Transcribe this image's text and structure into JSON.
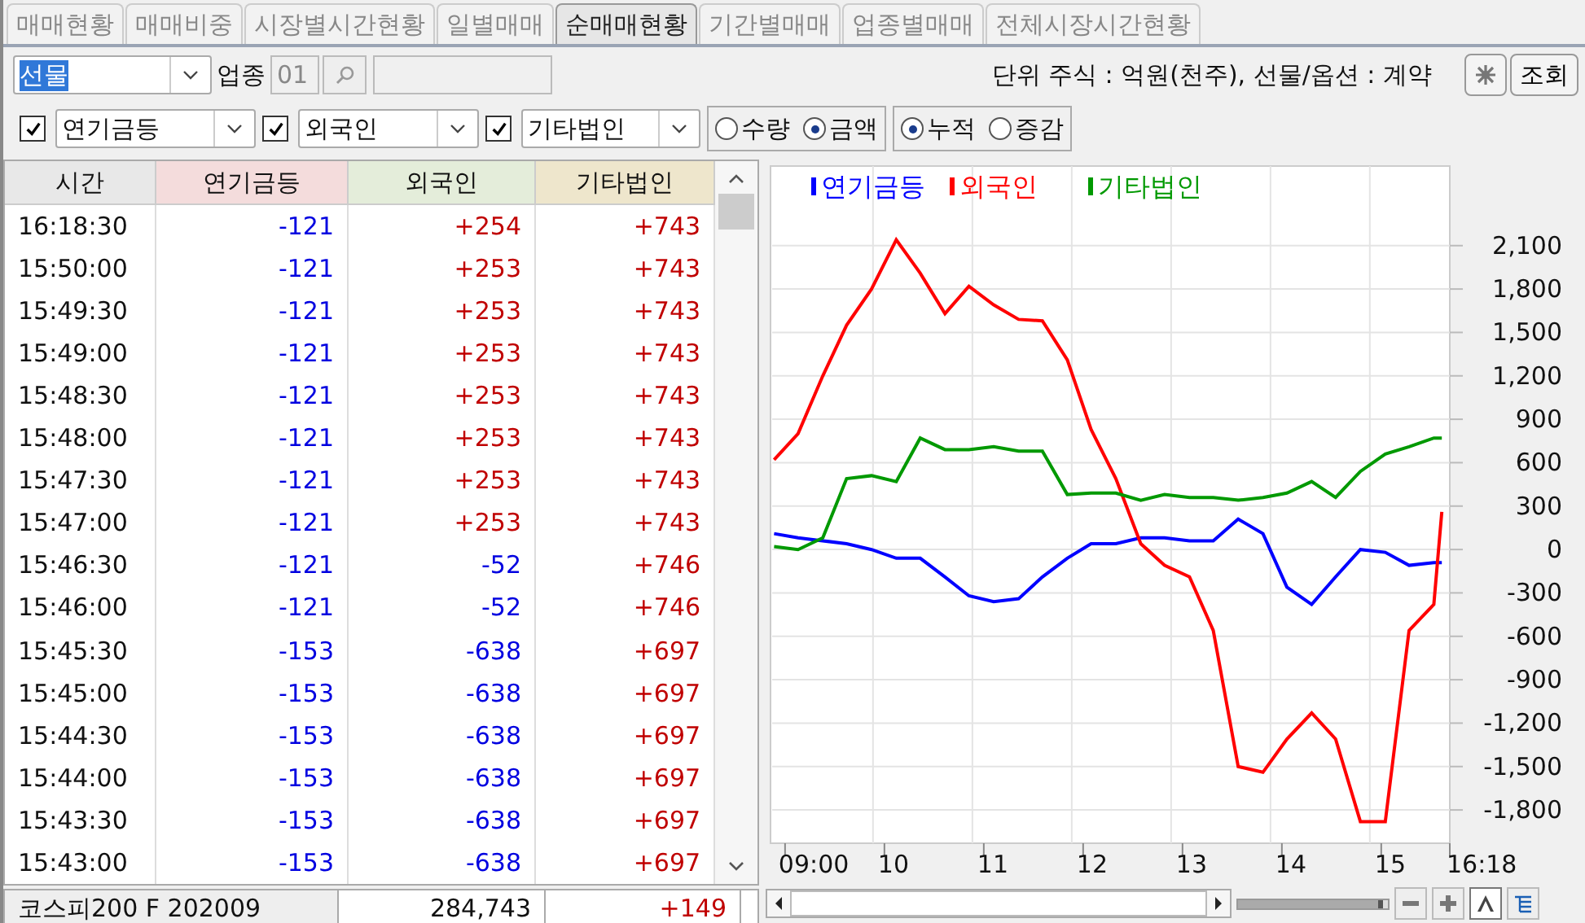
{
  "tabs": [
    {
      "label": "매매현황",
      "selected": false
    },
    {
      "label": "매매비중",
      "selected": false
    },
    {
      "label": "시장별시간현황",
      "selected": false
    },
    {
      "label": "일별매매",
      "selected": false
    },
    {
      "label": "순매매현황",
      "selected": true
    },
    {
      "label": "기간별매매",
      "selected": false
    },
    {
      "label": "업종별매매",
      "selected": false
    },
    {
      "label": "전체시장시간현황",
      "selected": false
    }
  ],
  "toolbar": {
    "market": "선물",
    "sector_label": "업종",
    "sector_code": "01",
    "unit_note": "단위 주식 : 억원(천주), 선물/옵션 : 계약",
    "query_button": "조회"
  },
  "filters": [
    {
      "label": "연기금등",
      "checked": true
    },
    {
      "label": "외국인",
      "checked": true
    },
    {
      "label": "기타법인",
      "checked": true
    }
  ],
  "radio_groups": [
    [
      {
        "label": "수량",
        "selected": false
      },
      {
        "label": "금액",
        "selected": true
      }
    ],
    [
      {
        "label": "누적",
        "selected": true
      },
      {
        "label": "증감",
        "selected": false
      }
    ]
  ],
  "table": {
    "columns": [
      "시간",
      "연기금등",
      "외국인",
      "기타법인"
    ],
    "rows": [
      [
        "16:18:30",
        "-121",
        "+254",
        "+743"
      ],
      [
        "15:50:00",
        "-121",
        "+253",
        "+743"
      ],
      [
        "15:49:30",
        "-121",
        "+253",
        "+743"
      ],
      [
        "15:49:00",
        "-121",
        "+253",
        "+743"
      ],
      [
        "15:48:30",
        "-121",
        "+253",
        "+743"
      ],
      [
        "15:48:00",
        "-121",
        "+253",
        "+743"
      ],
      [
        "15:47:30",
        "-121",
        "+253",
        "+743"
      ],
      [
        "15:47:00",
        "-121",
        "+253",
        "+743"
      ],
      [
        "15:46:30",
        "-121",
        "-52",
        "+746"
      ],
      [
        "15:46:00",
        "-121",
        "-52",
        "+746"
      ],
      [
        "15:45:30",
        "-153",
        "-638",
        "+697"
      ],
      [
        "15:45:00",
        "-153",
        "-638",
        "+697"
      ],
      [
        "15:44:30",
        "-153",
        "-638",
        "+697"
      ],
      [
        "15:44:00",
        "-153",
        "-638",
        "+697"
      ],
      [
        "15:43:30",
        "-153",
        "-638",
        "+697"
      ],
      [
        "15:43:00",
        "-153",
        "-638",
        "+697"
      ]
    ]
  },
  "footer": {
    "name": "코스피200 F 202009",
    "price": "284,743",
    "change": "+149"
  },
  "chart": {
    "chart_data": {
      "type": "line",
      "grid": true,
      "legend": true,
      "x": [
        8.89,
        9.13,
        9.38,
        9.62,
        9.87,
        10.12,
        10.36,
        10.61,
        10.85,
        11.1,
        11.35,
        11.59,
        11.84,
        12.08,
        12.33,
        12.58,
        12.82,
        13.07,
        13.31,
        13.56,
        13.81,
        14.05,
        14.3,
        14.54,
        14.79,
        15.04,
        15.28,
        15.53,
        15.61
      ],
      "series": [
        {
          "name": "연기금등",
          "color": "#0000ff",
          "values": [
            110,
            80,
            60,
            40,
            0,
            -60,
            -60,
            -190,
            -320,
            -360,
            -340,
            -190,
            -60,
            40,
            40,
            80,
            80,
            60,
            60,
            210,
            110,
            -260,
            -380,
            -190,
            0,
            -20,
            -110,
            -90,
            -90
          ]
        },
        {
          "name": "외국인",
          "color": "#ff0000",
          "values": [
            620,
            800,
            1200,
            1550,
            1800,
            2140,
            1910,
            1630,
            1820,
            1690,
            1590,
            1580,
            1310,
            830,
            490,
            40,
            -110,
            -190,
            -560,
            -1500,
            -1540,
            -1310,
            -1130,
            -1310,
            -1880,
            -1880,
            -560,
            -380,
            260
          ]
        },
        {
          "name": "기타법인",
          "color": "#009900",
          "values": [
            20,
            0,
            80,
            490,
            510,
            470,
            770,
            690,
            690,
            710,
            680,
            680,
            380,
            390,
            390,
            340,
            380,
            360,
            360,
            340,
            360,
            390,
            470,
            360,
            540,
            660,
            710,
            770,
            770
          ]
        }
      ],
      "xlim": [
        8.87,
        15.69
      ],
      "ylim": [
        -2030,
        2650
      ],
      "xticks": [
        {
          "value": 9,
          "label": "09:00"
        },
        {
          "value": 10,
          "label": "10"
        },
        {
          "value": 11,
          "label": "11"
        },
        {
          "value": 12,
          "label": "12"
        },
        {
          "value": 13,
          "label": "13"
        },
        {
          "value": 14,
          "label": "14"
        },
        {
          "value": 15,
          "label": "15"
        }
      ],
      "yticks": [
        {
          "value": 2100,
          "label": "2,100"
        },
        {
          "value": 1800,
          "label": "1,800"
        },
        {
          "value": 1500,
          "label": "1,500"
        },
        {
          "value": 1200,
          "label": "1,200"
        },
        {
          "value": 900,
          "label": "900"
        },
        {
          "value": 600,
          "label": "600"
        },
        {
          "value": 300,
          "label": "300"
        },
        {
          "value": 0,
          "label": "0"
        },
        {
          "value": -300,
          "label": "-300"
        },
        {
          "value": -600,
          "label": "-600"
        },
        {
          "value": -900,
          "label": "-900"
        },
        {
          "value": -1200,
          "label": "-1,200"
        },
        {
          "value": -1500,
          "label": "-1,500"
        },
        {
          "value": -1800,
          "label": "-1,800"
        }
      ]
    },
    "end_time_label": "16:18",
    "zoom_slider": {
      "level": 0.97
    }
  }
}
